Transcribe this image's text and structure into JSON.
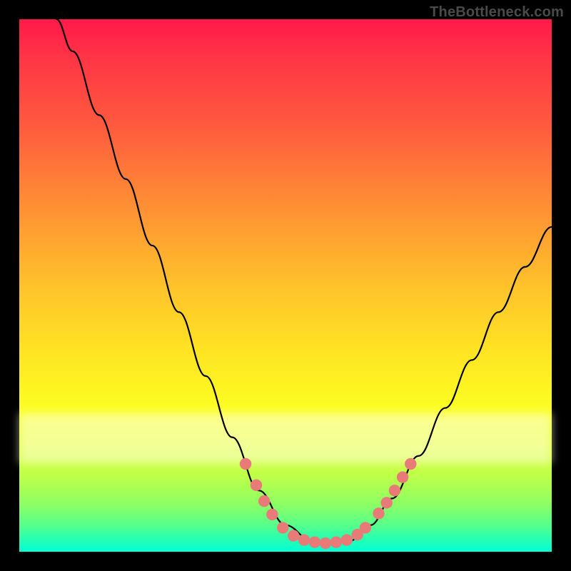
{
  "watermark": "TheBottleneck.com",
  "chart_data": {
    "type": "line",
    "title": "",
    "xlabel": "",
    "ylabel": "",
    "xlim": [
      0,
      100
    ],
    "ylim": [
      0,
      100
    ],
    "grid": false,
    "background_gradient": {
      "stops": [
        {
          "pos": 0.0,
          "color": "#ff1a4a"
        },
        {
          "pos": 0.08,
          "color": "#ff3745"
        },
        {
          "pos": 0.2,
          "color": "#ff5a3e"
        },
        {
          "pos": 0.35,
          "color": "#ff8f34"
        },
        {
          "pos": 0.5,
          "color": "#ffc22b"
        },
        {
          "pos": 0.64,
          "color": "#ffe822"
        },
        {
          "pos": 0.74,
          "color": "#fbff23"
        },
        {
          "pos": 0.8,
          "color": "#e1ff35"
        },
        {
          "pos": 0.86,
          "color": "#bcff4a"
        },
        {
          "pos": 0.91,
          "color": "#8dff63"
        },
        {
          "pos": 0.95,
          "color": "#57ff8a"
        },
        {
          "pos": 0.98,
          "color": "#20ffb8"
        },
        {
          "pos": 1.0,
          "color": "#05ffd6"
        }
      ]
    },
    "series": [
      {
        "name": "bottleneck-curve",
        "color": "#000000",
        "points": [
          {
            "x": 7.0,
            "y": 100.0
          },
          {
            "x": 10.0,
            "y": 94.0
          },
          {
            "x": 15.0,
            "y": 82.0
          },
          {
            "x": 20.0,
            "y": 70.0
          },
          {
            "x": 25.0,
            "y": 57.5
          },
          {
            "x": 30.0,
            "y": 45.0
          },
          {
            "x": 35.0,
            "y": 33.0
          },
          {
            "x": 40.0,
            "y": 21.5
          },
          {
            "x": 45.0,
            "y": 11.5
          },
          {
            "x": 50.0,
            "y": 5.0
          },
          {
            "x": 55.0,
            "y": 2.0
          },
          {
            "x": 58.0,
            "y": 1.5
          },
          {
            "x": 62.0,
            "y": 2.0
          },
          {
            "x": 66.0,
            "y": 5.0
          },
          {
            "x": 70.0,
            "y": 10.0
          },
          {
            "x": 75.0,
            "y": 18.0
          },
          {
            "x": 80.0,
            "y": 27.0
          },
          {
            "x": 85.0,
            "y": 36.0
          },
          {
            "x": 90.0,
            "y": 45.0
          },
          {
            "x": 95.0,
            "y": 53.5
          },
          {
            "x": 100.0,
            "y": 61.0
          }
        ]
      }
    ],
    "markers": {
      "name": "highlight-points",
      "color": "#e87a78",
      "radius_pct": 1.1,
      "points": [
        {
          "x": 42.5,
          "y": 16.5
        },
        {
          "x": 44.5,
          "y": 12.5
        },
        {
          "x": 46.0,
          "y": 9.5
        },
        {
          "x": 47.5,
          "y": 7.0
        },
        {
          "x": 49.5,
          "y": 4.5
        },
        {
          "x": 51.5,
          "y": 3.0
        },
        {
          "x": 53.5,
          "y": 2.2
        },
        {
          "x": 55.5,
          "y": 1.8
        },
        {
          "x": 57.5,
          "y": 1.6
        },
        {
          "x": 59.5,
          "y": 1.8
        },
        {
          "x": 61.5,
          "y": 2.2
        },
        {
          "x": 63.5,
          "y": 3.2
        },
        {
          "x": 65.0,
          "y": 4.5
        },
        {
          "x": 67.5,
          "y": 7.2
        },
        {
          "x": 69.0,
          "y": 9.2
        },
        {
          "x": 70.5,
          "y": 11.5
        },
        {
          "x": 72.0,
          "y": 14.0
        },
        {
          "x": 73.5,
          "y": 16.5
        }
      ]
    }
  }
}
